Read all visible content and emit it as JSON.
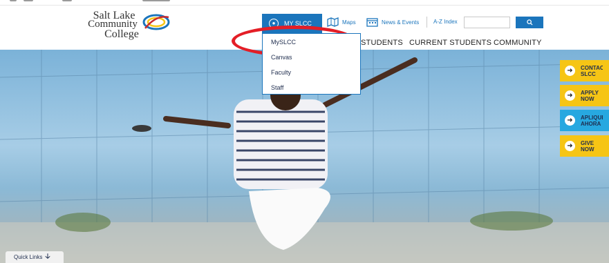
{
  "logo": {
    "line1": "Salt Lake",
    "line2": "Community",
    "line3": "College"
  },
  "utility": {
    "my_slcc": "MY SLCC",
    "maps": "Maps",
    "news_events": "News & Events",
    "az_index": "A-Z Index",
    "search_placeholder": "",
    "search_icon": "search-icon"
  },
  "nav": [
    {
      "label": "STUDENTS"
    },
    {
      "label": "CURRENT STUDENTS"
    },
    {
      "label": "COMMUNITY"
    }
  ],
  "dropdown": {
    "items": [
      {
        "label": "MySLCC"
      },
      {
        "label": "Canvas"
      },
      {
        "label": "Faculty"
      },
      {
        "label": "Staff"
      }
    ]
  },
  "side_buttons": [
    {
      "label": "CONTACT\nSLCC",
      "color": "#f6c515"
    },
    {
      "label": "APPLY\nNOW",
      "color": "#f6c515"
    },
    {
      "label": "APLIQUE\nAHORA",
      "color": "#27a8e0"
    },
    {
      "label": "GIVE\nNOW",
      "color": "#f6c515"
    }
  ],
  "quick_links": {
    "label": "Quick Links"
  },
  "colors": {
    "brand_blue": "#1b75bc",
    "annotation_red": "#e41e26",
    "cta_yellow": "#f6c515",
    "cta_blue": "#27a8e0"
  }
}
